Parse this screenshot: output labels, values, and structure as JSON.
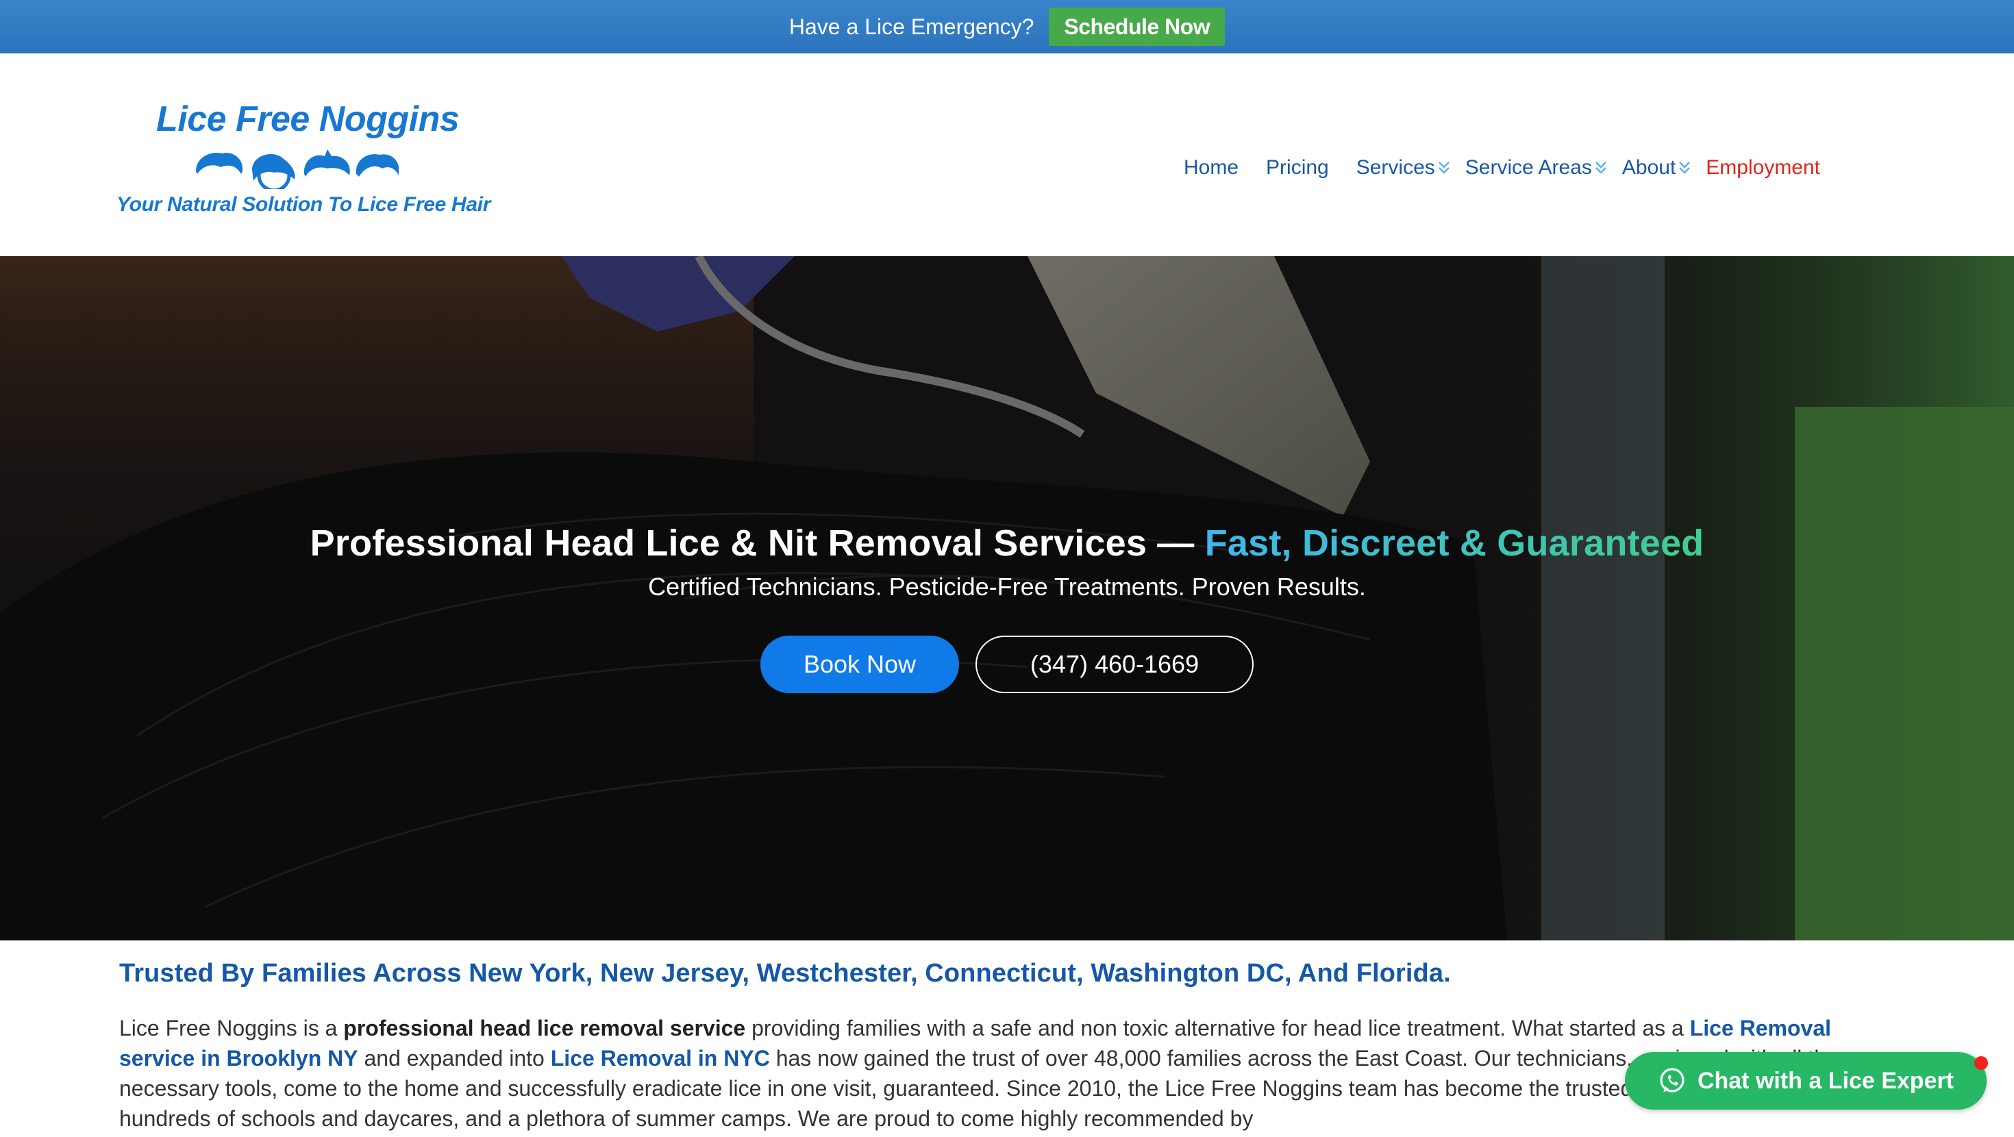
{
  "topbar": {
    "message": "Have a Lice Emergency?",
    "cta": "Schedule Now"
  },
  "logo": {
    "title": "Lice Free Noggins",
    "tagline": "Your Natural Solution To Lice Free Hair"
  },
  "nav": {
    "items": [
      {
        "label": "Home"
      },
      {
        "label": "Pricing"
      },
      {
        "label": "Services"
      },
      {
        "label": "Service Areas"
      },
      {
        "label": "About"
      },
      {
        "label": "Employment"
      }
    ]
  },
  "hero": {
    "title_main": "Professional Head Lice & Nit Removal Services — ",
    "title_accent": "Fast, Discreet & Guaranteed",
    "subtitle": "Certified Technicians. Pesticide-Free Treatments. Proven Results.",
    "book_label": "Book Now",
    "phone_label": "(347) 460-1669"
  },
  "content": {
    "heading": "Trusted By Families Across New York, New Jersey, Westchester, Connecticut, Washington DC, And Florida.",
    "p1": "Lice Free Noggins is a ",
    "p_bold": "professional head lice removal service",
    "p2": " providing families with a safe and non toxic alternative for head lice treatment. What started as a ",
    "link1": "Lice Removal service in Brooklyn NY",
    "p3": " and expanded into ",
    "link2": "Lice Removal in NYC",
    "p4": " has now gained the trust of over 48,000 families across the East Coast. Our technicians, equipped with all the necessary tools, come to the home and successfully eradicate lice in one visit, guaranteed. Since 2010, the Lice Free Noggins team has become the trusted company for families, hundreds of schools and daycares, and a plethora of summer camps. We are proud to come highly recommended by"
  },
  "chat": {
    "label": "Chat with a Lice Expert"
  },
  "colors": {
    "topbar": "#2b74bd",
    "cta_green": "#47a94a",
    "brand_blue": "#1778d2",
    "nav_blue": "#1a57a8",
    "employment_red": "#e0241c",
    "book_button": "#0f7ae8",
    "chat_green": "#26b864"
  },
  "icons": {
    "chat": "whatsapp-icon",
    "nav_dropdown": "chevron-down-icon"
  }
}
